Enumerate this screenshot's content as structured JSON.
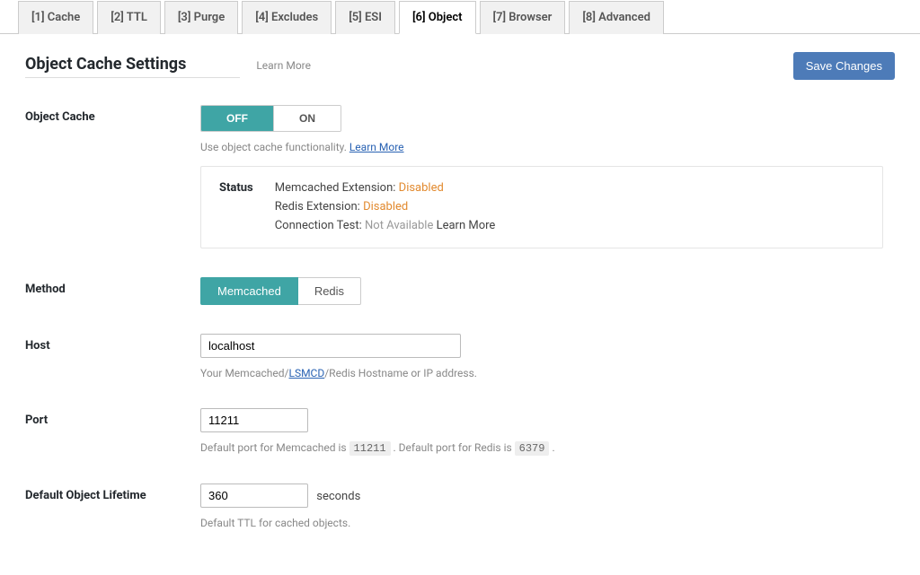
{
  "tabs": [
    {
      "label": "[1] Cache",
      "active": false
    },
    {
      "label": "[2] TTL",
      "active": false
    },
    {
      "label": "[3] Purge",
      "active": false
    },
    {
      "label": "[4] Excludes",
      "active": false
    },
    {
      "label": "[5] ESI",
      "active": false
    },
    {
      "label": "[6] Object",
      "active": true
    },
    {
      "label": "[7] Browser",
      "active": false
    },
    {
      "label": "[8] Advanced",
      "active": false
    }
  ],
  "header": {
    "title": "Object Cache Settings",
    "learn_more": "Learn More",
    "save_button": "Save Changes"
  },
  "object_cache": {
    "label": "Object Cache",
    "off": "OFF",
    "on": "ON",
    "desc_prefix": "Use object cache functionality. ",
    "desc_link": "Learn More"
  },
  "status": {
    "label": "Status",
    "memcached_label": "Memcached Extension: ",
    "memcached_value": "Disabled",
    "redis_label": "Redis Extension: ",
    "redis_value": "Disabled",
    "conn_label": "Connection Test: ",
    "conn_value": "Not Available ",
    "conn_link": "Learn More"
  },
  "method": {
    "label": "Method",
    "memcached": "Memcached",
    "redis": "Redis"
  },
  "host": {
    "label": "Host",
    "value": "localhost",
    "desc_prefix": "Your Memcached/",
    "desc_link": "LSMCD",
    "desc_suffix": "/Redis Hostname or IP address."
  },
  "port": {
    "label": "Port",
    "value": "11211",
    "desc_prefix": "Default port for Memcached is ",
    "chip1": "11211",
    "desc_mid": " . Default port for Redis is ",
    "chip2": "6379",
    "desc_suffix": " ."
  },
  "lifetime": {
    "label": "Default Object Lifetime",
    "value": "360",
    "unit": "seconds",
    "desc": "Default TTL for cached objects."
  }
}
